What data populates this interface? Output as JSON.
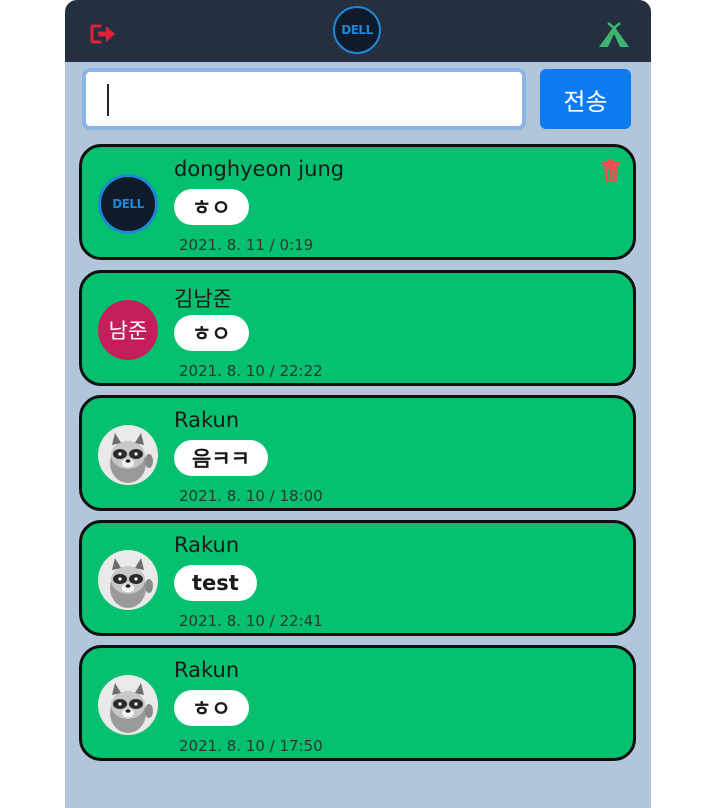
{
  "header": {
    "logout_icon": "logout-icon",
    "logo_text": "DELL",
    "tent_icon": "tent-icon",
    "colors": {
      "background": "#242f40",
      "logout": "#e0213a",
      "tent": "#3cb371"
    }
  },
  "composer": {
    "input_value": "",
    "input_placeholder": "",
    "send_label": "전송"
  },
  "messages": [
    {
      "author": "donghyeon jung",
      "avatar": "dell-logo",
      "avatar_text": "DELL",
      "text": "ㅎㅇ",
      "timestamp": "2021. 8. 11 / 0:19",
      "deletable": true
    },
    {
      "author": "김남준",
      "avatar": "initials",
      "avatar_text": "남준",
      "text": "ㅎㅇ",
      "timestamp": "2021. 8. 10 / 22:22",
      "deletable": false
    },
    {
      "author": "Rakun",
      "avatar": "raccoon-photo",
      "text": "음ㅋㅋ",
      "timestamp": "2021. 8. 10 / 18:00",
      "deletable": false
    },
    {
      "author": "Rakun",
      "avatar": "raccoon-photo",
      "text": "test",
      "timestamp": "2021. 8. 10 / 22:41",
      "deletable": false
    },
    {
      "author": "Rakun",
      "avatar": "raccoon-photo",
      "text": "ㅎㅇ",
      "timestamp": "2021. 8. 10 / 17:50",
      "deletable": false
    }
  ],
  "colors": {
    "app_background": "#b2c6db",
    "card": "#04c06f",
    "send_button": "#0d7cf2",
    "delete_icon": "#e2564a"
  }
}
